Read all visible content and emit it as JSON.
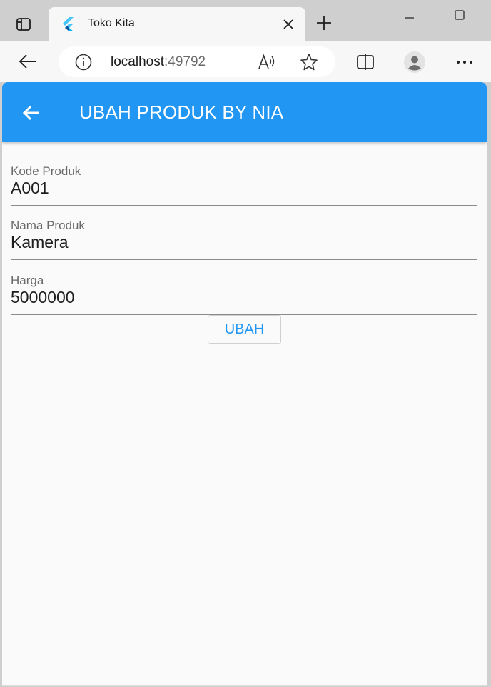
{
  "browser": {
    "tab": {
      "title": "Toko Kita",
      "favicon": "flutter-logo-icon"
    },
    "address": {
      "host": "localhost",
      "port": ":49792"
    },
    "icons": {
      "tab_actions": "tab-actions-icon",
      "close_tab": "close-icon",
      "new_tab": "plus-icon",
      "minimize": "minimize-icon",
      "maximize": "maximize-icon",
      "back": "arrow-left-icon",
      "site_info": "info-icon",
      "read_aloud": "read-aloud-icon",
      "favorite": "star-icon",
      "split_screen": "split-screen-icon",
      "profile": "profile-icon",
      "more": "more-icon"
    }
  },
  "app": {
    "appbar": {
      "title": "UBAH PRODUK BY NIA",
      "color": "#2196f3"
    },
    "form": {
      "fields": [
        {
          "label": "Kode Produk",
          "value": "A001"
        },
        {
          "label": "Nama Produk",
          "value": "Kamera"
        },
        {
          "label": "Harga",
          "value": "5000000"
        }
      ],
      "submit_label": "UBAH"
    }
  }
}
